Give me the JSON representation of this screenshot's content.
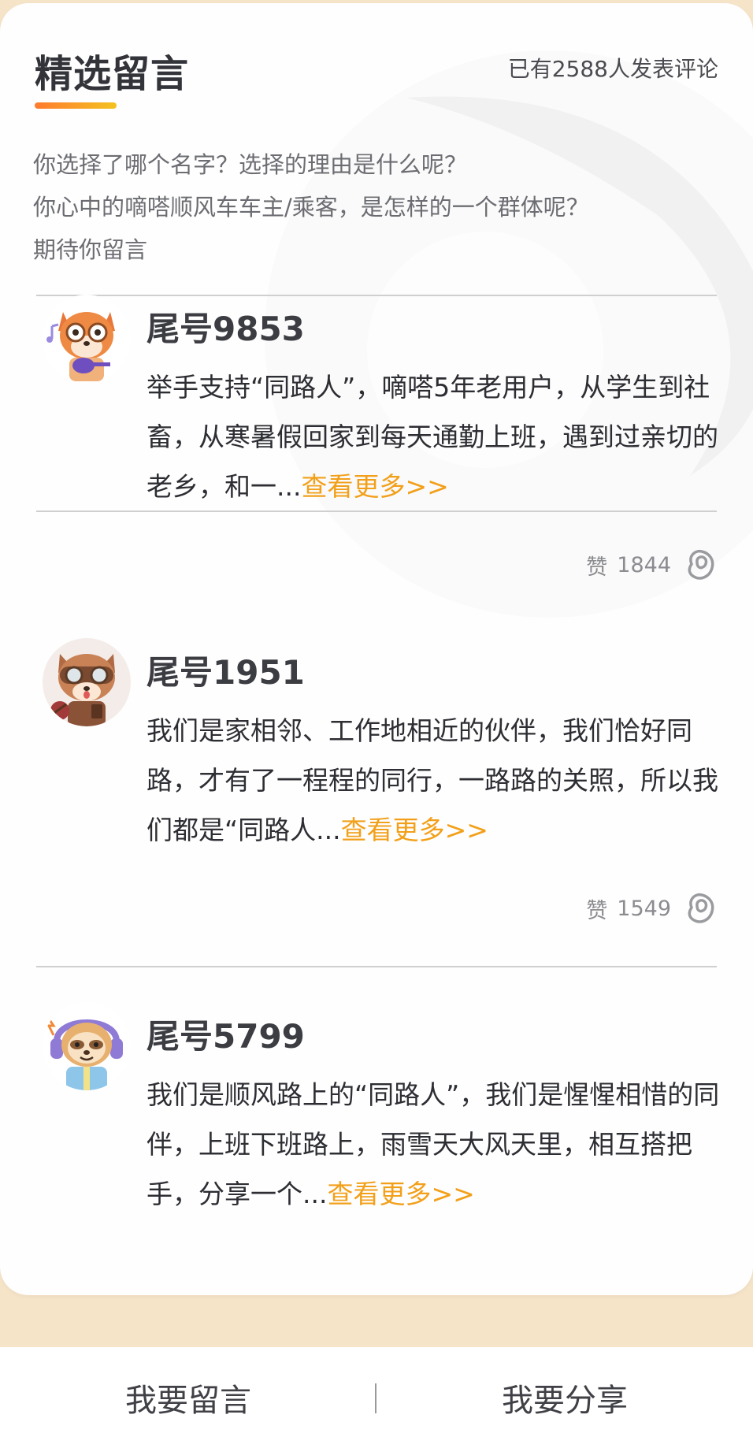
{
  "section": {
    "title": "精选留言",
    "count_text": "已有2588人发表评论",
    "intro_lines": [
      "你选择了哪个名字？选择的理由是什么呢？",
      "你心中的嘀嗒顺风车车主/乘客，是怎样的一个群体呢？",
      "期待你留言"
    ]
  },
  "comments": [
    {
      "user": "尾号9853",
      "avatar_icon": "fox-guitar-avatar",
      "text": "举手支持“同路人”，嘀嗒5年老用户，从学生到社畜，从寒暑假回家到每天通勤上班，遇到过亲切的老乡，和一...",
      "more": "查看更多>>",
      "likes_label": "赞",
      "likes": "1844",
      "like_icon": "like-hand-icon"
    },
    {
      "user": "尾号1951",
      "avatar_icon": "raccoon-goggles-avatar",
      "text": "我们是家相邻、工作地相近的伙伴，我们恰好同路，才有了一程程的同行，一路路的关照，所以我们都是“同路人...",
      "more": "查看更多>>",
      "likes_label": "赞",
      "likes": "1549",
      "like_icon": "like-hand-icon"
    },
    {
      "user": "尾号5799",
      "avatar_icon": "sloth-headphones-avatar",
      "text": "我们是顺风路上的“同路人”，我们是惺惺相惜的同伴，上班下班路上，雨雪天大风天里，相互搭把手，分享一个...",
      "more": "查看更多>>"
    }
  ],
  "bottom_bar": {
    "comment_label": "我要留言",
    "share_label": "我要分享"
  },
  "colors": {
    "page_bg": "#f6e4c8",
    "accent_link": "#f2a01a",
    "title_underline_start": "#ff7a2e",
    "title_underline_end": "#f4c21f"
  }
}
